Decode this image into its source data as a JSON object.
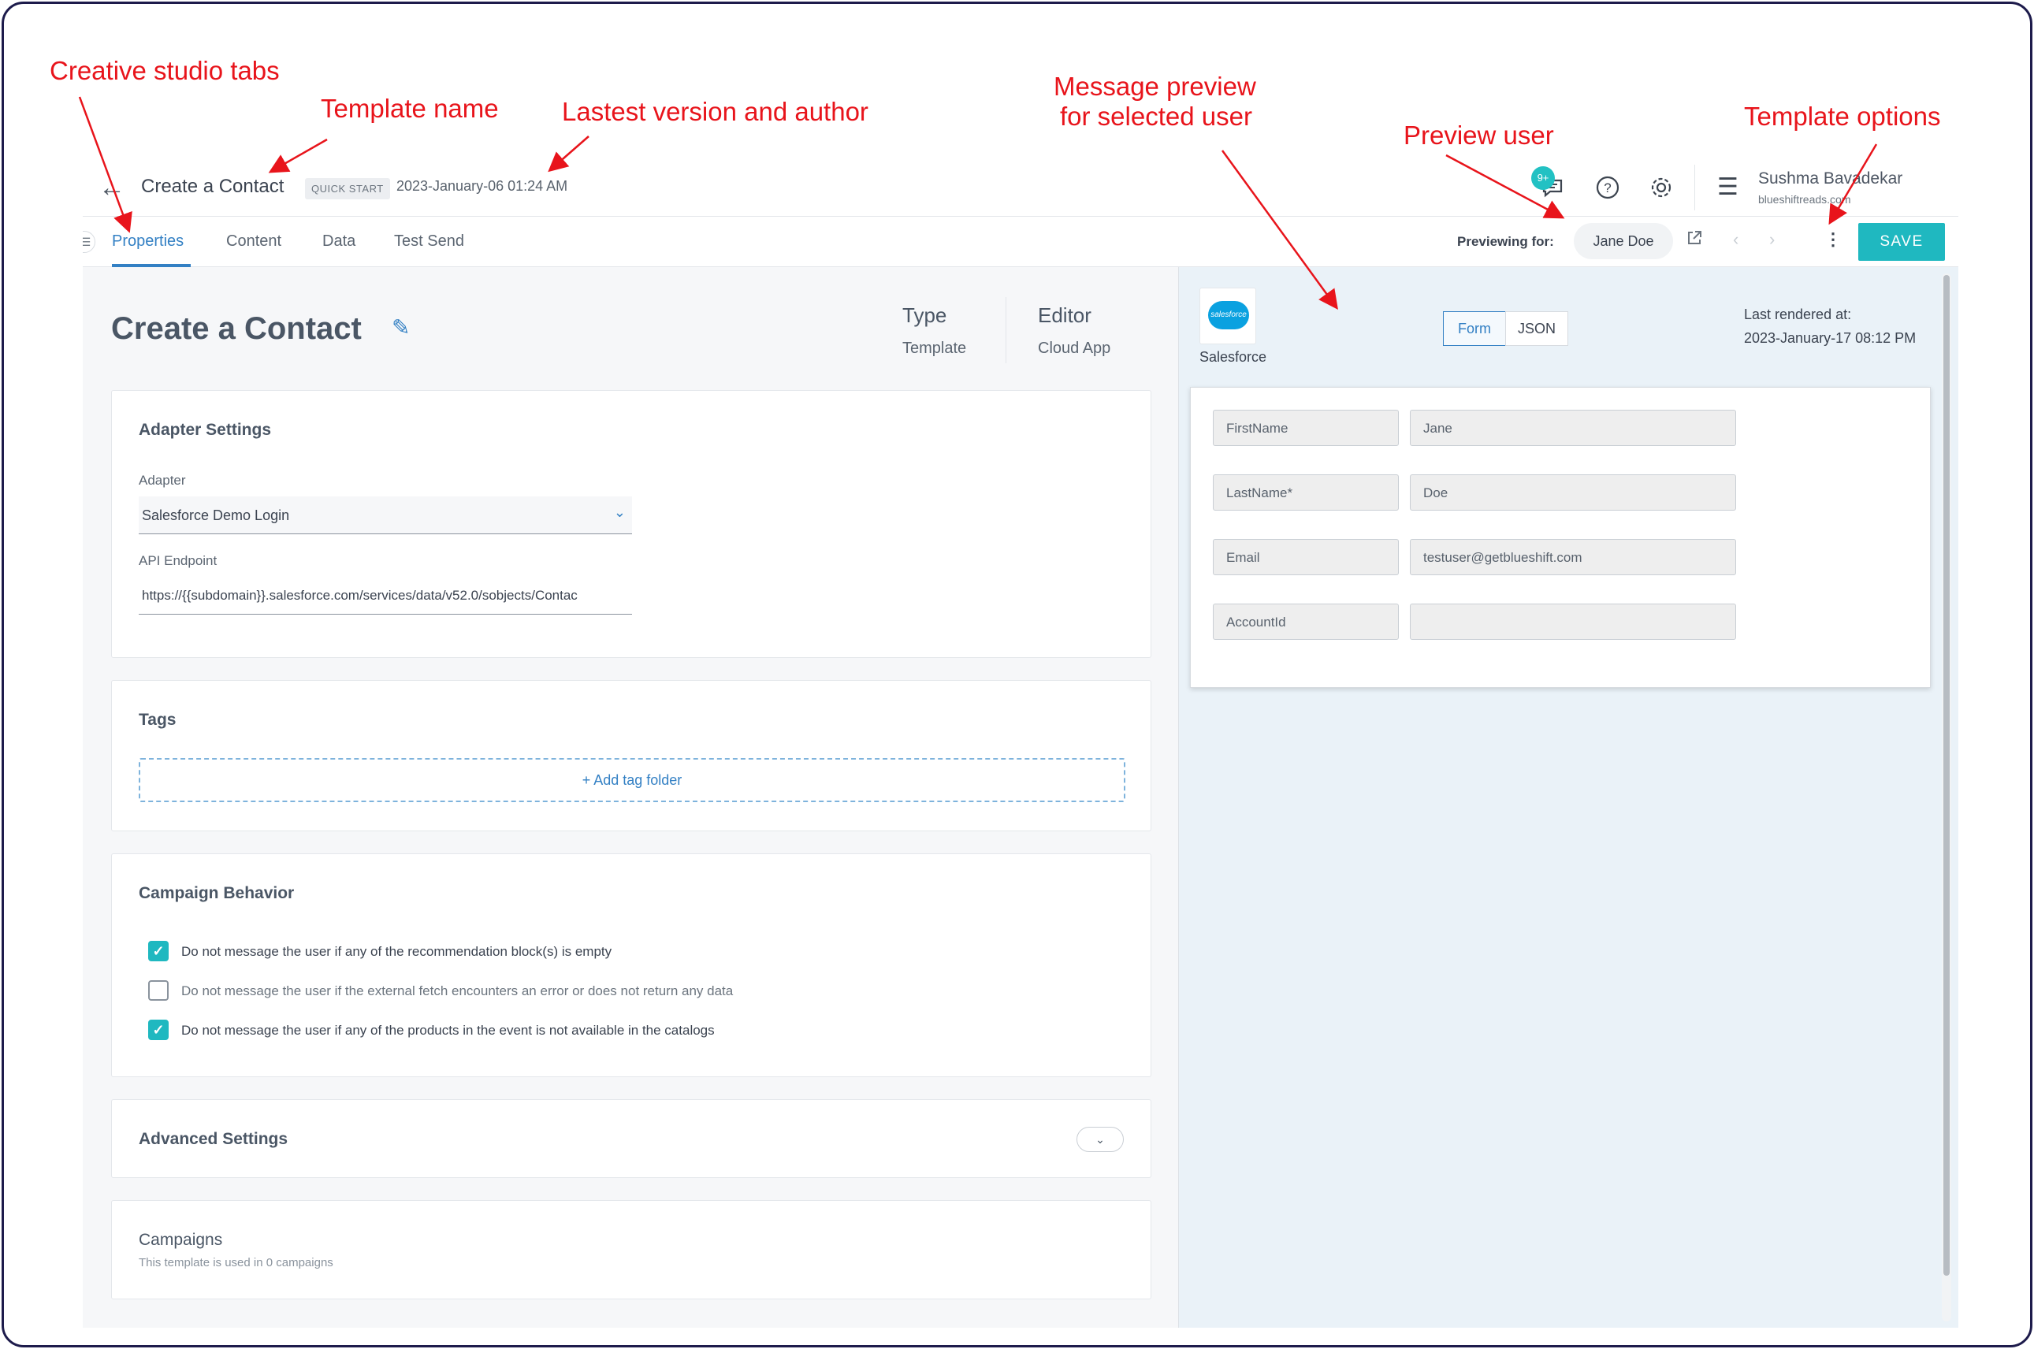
{
  "annotations": {
    "creative_tabs": "Creative studio tabs",
    "template_name": "Template name",
    "latest_version": "Lastest version and author",
    "message_preview_l1": "Message preview",
    "message_preview_l2": "for selected user",
    "preview_user": "Preview user",
    "template_options": "Template options",
    "color": "#e8141b"
  },
  "header": {
    "back_icon": "arrow-left-icon",
    "template_name": "Create a Contact",
    "badge": "QUICK START",
    "version": "2023-January-06 01:24 AM",
    "notification_count": "9+",
    "user_name": "Sushma Bavadekar",
    "user_domain": "blueshiftreads.com"
  },
  "tabs": [
    "Properties",
    "Content",
    "Data",
    "Test Send"
  ],
  "active_tab": "Properties",
  "preview": {
    "label": "Previewing for:",
    "user": "Jane Doe",
    "save_label": "SAVE"
  },
  "properties": {
    "title": "Create a Contact",
    "type_label": "Type",
    "type_value": "Template",
    "editor_label": "Editor",
    "editor_value": "Cloud App"
  },
  "adapter_settings": {
    "heading": "Adapter Settings",
    "adapter_label": "Adapter",
    "adapter_value": "Salesforce Demo Login",
    "endpoint_label": "API Endpoint",
    "endpoint_value": "https://{{subdomain}}.salesforce.com/services/data/v52.0/sobjects/Contac"
  },
  "tags": {
    "heading": "Tags",
    "add_label": "+ Add tag folder"
  },
  "campaign_behavior": {
    "heading": "Campaign Behavior",
    "options": [
      {
        "label": "Do not message the user if any of the recommendation block(s) is empty",
        "checked": true
      },
      {
        "label": "Do not message the user if the external fetch encounters an error or does not return any data",
        "checked": false
      },
      {
        "label": "Do not message the user if any of the products in the event is not available in the catalogs",
        "checked": true
      }
    ]
  },
  "advanced": {
    "heading": "Advanced Settings"
  },
  "campaigns": {
    "heading": "Campaigns",
    "subtext": "This template is used in 0 campaigns"
  },
  "preview_pane": {
    "logo_text": "salesforce",
    "app_name": "Salesforce",
    "tab_form": "Form",
    "tab_json": "JSON",
    "last_rendered_label": "Last rendered at:",
    "last_rendered_value": "2023-January-17 08:12 PM",
    "fields": [
      {
        "label": "FirstName",
        "value": "Jane"
      },
      {
        "label": "LastName*",
        "value": "Doe"
      },
      {
        "label": "Email",
        "value": "testuser@getblueshift.com"
      },
      {
        "label": "AccountId",
        "value": ""
      }
    ]
  },
  "colors": {
    "accent": "#3380c4",
    "save": "#1fb8c0",
    "brand_sf": "#0aa1e0"
  }
}
